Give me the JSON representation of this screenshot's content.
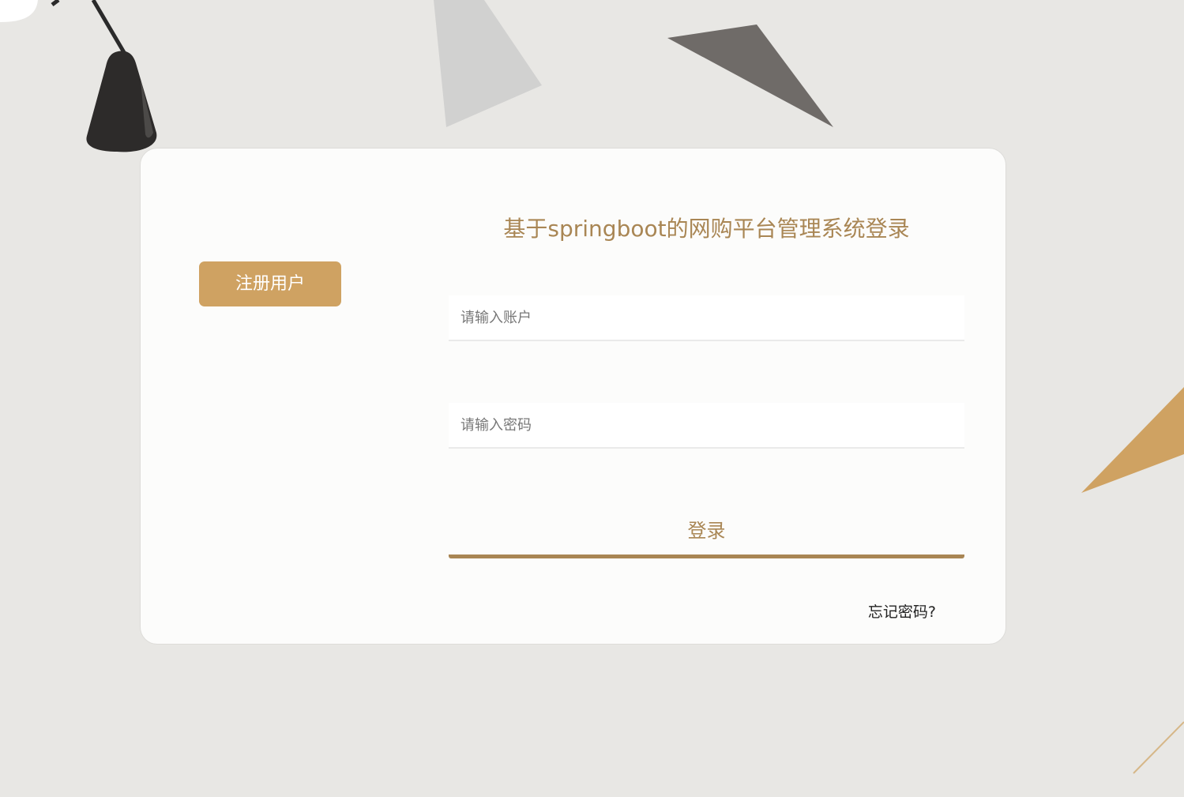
{
  "page": {
    "title": "基于springboot的网购平台管理系统登录"
  },
  "register": {
    "label": "注册用户"
  },
  "account_field": {
    "placeholder": "请输入账户",
    "value": ""
  },
  "password_field": {
    "placeholder": "请输入密码",
    "value": ""
  },
  "login": {
    "label": "登录"
  },
  "forgot": {
    "label": "忘记密码?"
  },
  "colors": {
    "background": "#e8e7e4",
    "card": "#fcfcfb",
    "accent": "#cfa262",
    "title_text": "#a98654",
    "dark_shape": "#6f6b68",
    "light_shape": "#d1d1d0"
  }
}
